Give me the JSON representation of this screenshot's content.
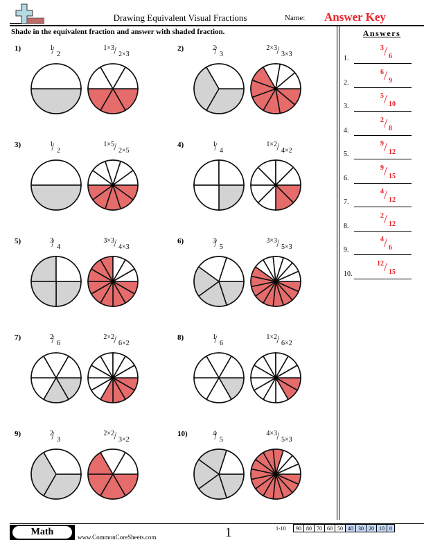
{
  "header": {
    "title": "Drawing Equivalent Visual Fractions",
    "name_label": "Name:",
    "name_value": "Answer Key",
    "logo_icon": "plus-minus-logo-icon"
  },
  "instructions": "Shade in the equivalent fraction and answer with shaded fraction.",
  "colors": {
    "original_shade": "#d3d3d3",
    "equivalent_shade": "#e66c6c",
    "answer_text": "#e8242a",
    "score_low_bg": "#c6dbf7"
  },
  "problems": [
    {
      "label": "1)",
      "num": "1",
      "den": "2",
      "mult": "3",
      "eq_num": "1×3",
      "eq_den": "2×3",
      "shaded": 1,
      "parts": 2,
      "eq_shaded": 3,
      "eq_parts": 6
    },
    {
      "label": "2)",
      "num": "2",
      "den": "3",
      "mult": "3",
      "eq_num": "2×3",
      "eq_den": "3×3",
      "shaded": 2,
      "parts": 3,
      "eq_shaded": 6,
      "eq_parts": 9
    },
    {
      "label": "3)",
      "num": "1",
      "den": "2",
      "mult": "5",
      "eq_num": "1×5",
      "eq_den": "2×5",
      "shaded": 1,
      "parts": 2,
      "eq_shaded": 5,
      "eq_parts": 10
    },
    {
      "label": "4)",
      "num": "1",
      "den": "4",
      "mult": "2",
      "eq_num": "1×2",
      "eq_den": "4×2",
      "shaded": 1,
      "parts": 4,
      "eq_shaded": 2,
      "eq_parts": 8
    },
    {
      "label": "5)",
      "num": "3",
      "den": "4",
      "mult": "3",
      "eq_num": "3×3",
      "eq_den": "4×3",
      "shaded": 3,
      "parts": 4,
      "eq_shaded": 9,
      "eq_parts": 12
    },
    {
      "label": "6)",
      "num": "3",
      "den": "5",
      "mult": "3",
      "eq_num": "3×3",
      "eq_den": "5×3",
      "shaded": 3,
      "parts": 5,
      "eq_shaded": 9,
      "eq_parts": 15
    },
    {
      "label": "7)",
      "num": "2",
      "den": "6",
      "mult": "2",
      "eq_num": "2×2",
      "eq_den": "6×2",
      "shaded": 2,
      "parts": 6,
      "eq_shaded": 4,
      "eq_parts": 12
    },
    {
      "label": "8)",
      "num": "1",
      "den": "6",
      "mult": "2",
      "eq_num": "1×2",
      "eq_den": "6×2",
      "shaded": 1,
      "parts": 6,
      "eq_shaded": 2,
      "eq_parts": 12
    },
    {
      "label": "9)",
      "num": "2",
      "den": "3",
      "mult": "2",
      "eq_num": "2×2",
      "eq_den": "3×2",
      "shaded": 2,
      "parts": 3,
      "eq_shaded": 4,
      "eq_parts": 6
    },
    {
      "label": "10)",
      "num": "4",
      "den": "5",
      "mult": "3",
      "eq_num": "4×3",
      "eq_den": "5×3",
      "shaded": 4,
      "parts": 5,
      "eq_shaded": 12,
      "eq_parts": 15
    }
  ],
  "answers": {
    "heading": "Answers",
    "items": [
      {
        "index": "1.",
        "num": "3",
        "den": "6"
      },
      {
        "index": "2.",
        "num": "6",
        "den": "9"
      },
      {
        "index": "3.",
        "num": "5",
        "den": "10"
      },
      {
        "index": "4.",
        "num": "2",
        "den": "8"
      },
      {
        "index": "5.",
        "num": "9",
        "den": "12"
      },
      {
        "index": "6.",
        "num": "9",
        "den": "15"
      },
      {
        "index": "7.",
        "num": "4",
        "den": "12"
      },
      {
        "index": "8.",
        "num": "2",
        "den": "12"
      },
      {
        "index": "9.",
        "num": "4",
        "den": "6"
      },
      {
        "index": "10.",
        "num": "12",
        "den": "15"
      }
    ]
  },
  "footer": {
    "subject": "Math",
    "website": "www.CommonCoreSheets.com",
    "page_number": "1",
    "score_label": "1-10",
    "scores": [
      "90",
      "80",
      "70",
      "60",
      "50",
      "40",
      "30",
      "20",
      "10",
      "0"
    ],
    "low_scores": [
      "40",
      "30",
      "20",
      "10",
      "0"
    ]
  }
}
